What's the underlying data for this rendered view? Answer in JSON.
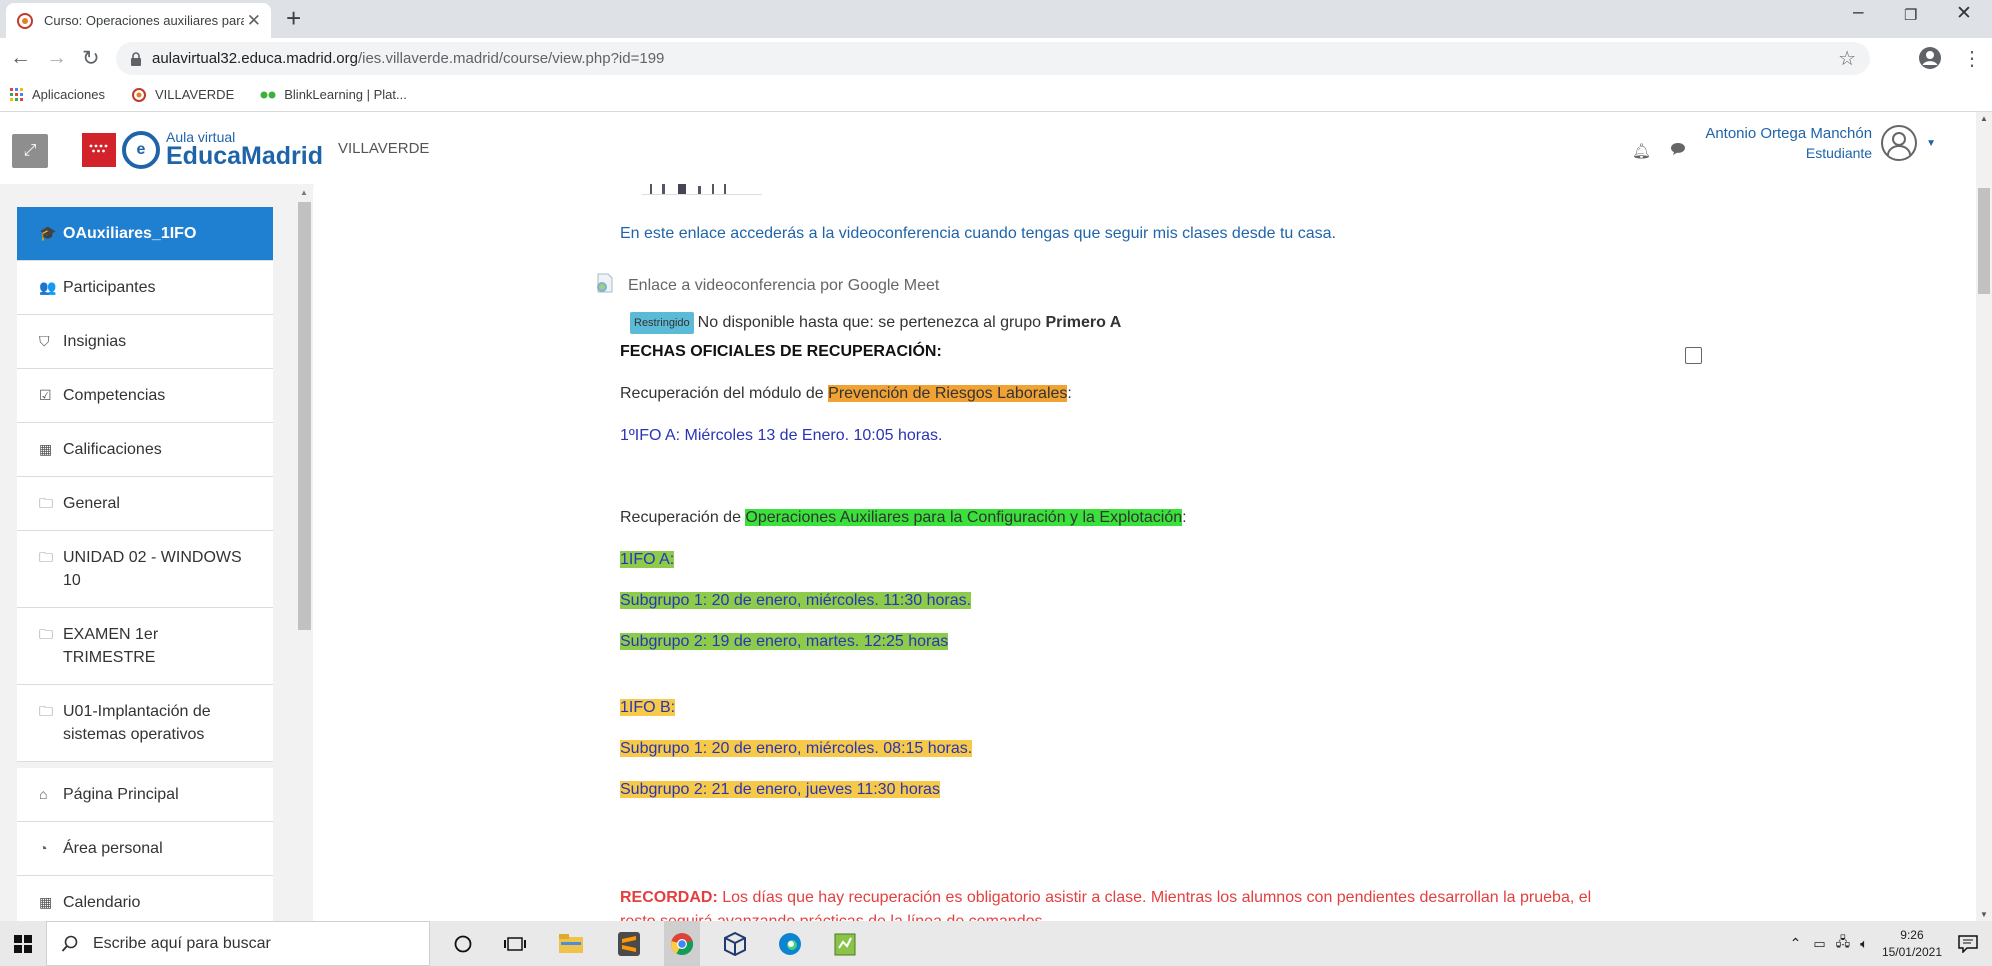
{
  "browser": {
    "tab_title": "Curso: Operaciones auxiliares para",
    "tab_close": "✕",
    "new_tab": "+",
    "url_host": "aulavirtual32.educa.madrid.org",
    "url_path": "/ies.villaverde.madrid/course/view.php?id=199",
    "bookmarks": [
      {
        "label": "Aplicaciones",
        "icon": "apps-grid-icon"
      },
      {
        "label": "VILLAVERDE",
        "icon": "site-favicon-icon"
      },
      {
        "label": "BlinkLearning | Plat...",
        "icon": "blink-icon"
      }
    ]
  },
  "header": {
    "logo_small": "Aula virtual",
    "logo_big": "EducaMadrid",
    "site_name": "VILLAVERDE",
    "user_name": "Antonio Ortega Manchón",
    "user_role": "Estudiante"
  },
  "sidebar": {
    "items": [
      {
        "label": "OAuxiliares_1IFO",
        "icon": "🎓"
      },
      {
        "label": "Participantes",
        "icon": "👥"
      },
      {
        "label": "Insignias",
        "icon": "⛉"
      },
      {
        "label": "Competencias",
        "icon": "☑"
      },
      {
        "label": "Calificaciones",
        "icon": "▦"
      },
      {
        "label": "General",
        "icon": "🗀"
      },
      {
        "label": "UNIDAD 02 - WINDOWS 10",
        "icon": "🗀"
      },
      {
        "label": "EXAMEN 1er TRIMESTRE",
        "icon": "🗀"
      },
      {
        "label": "U01-Implantación de sistemas operativos",
        "icon": "🗀"
      },
      {
        "label": "Página Principal",
        "icon": "⌂"
      },
      {
        "label": "Área personal",
        "icon": "◔"
      },
      {
        "label": "Calendario",
        "icon": "▦"
      }
    ]
  },
  "content": {
    "intro": "En este enlace accederás a la videoconferencia cuando tengas que seguir mis clases desde tu casa.",
    "meet_link": "Enlace a videoconferencia por Google Meet",
    "restricted_badge": "Restringido",
    "restricted_text": "No disponible hasta que: se pertenezca al grupo",
    "restricted_group": "Primero A",
    "heading": "FECHAS OFICIALES DE RECUPERACIÓN:",
    "prl_prefix": "Recuperación del módulo de",
    "prl_name": "Prevención de Riesgos Laborales",
    "prl_suffix": ":",
    "prl_date": "1ºIFO A: Miércoles 13 de Enero. 10:05 horas.",
    "oa_prefix": "Recuperación de",
    "oa_name": "Operaciones Auxiliares para la Configuración y la Explotación",
    "oa_suffix": ":",
    "group_a": "1IFO A:",
    "group_a_sub1": "Subgrupo 1: 20 de enero, miércoles. 11:30 horas.",
    "group_a_sub2": "Subgrupo 2: 19 de enero, martes. 12:25 horas",
    "group_b": "1IFO B:",
    "group_b_sub1": "Subgrupo 1: 20 de enero, miércoles. 08:15 horas.",
    "group_b_sub2": "Subgrupo 2: 21 de enero, jueves 11:30 horas",
    "reminder_label": "RECORDAD:",
    "reminder_text": "Los días que hay recuperación es obligatorio asistir a clase. Mientras los alumnos con pendientes desarrollan la prueba, el",
    "reminder_cont": "resto seguirá avanzando prácticas de la línea de comandos."
  },
  "taskbar": {
    "search_placeholder": "Escribe aquí para buscar",
    "time": "9:26",
    "date": "15/01/2021"
  },
  "colors": {
    "accent": "#1f7fd1",
    "link": "#1f64a9",
    "highlight_orange": "#f0a235",
    "highlight_green": "#3ae13a",
    "highlight_lightgreen": "#8ccc4a",
    "highlight_yellow": "#f6c949",
    "reminder_red": "#e53e3e"
  }
}
